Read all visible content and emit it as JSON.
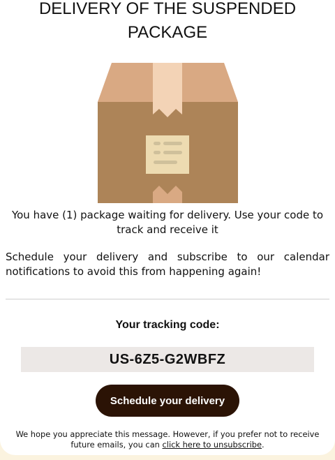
{
  "header": {
    "title": "DELIVERY OF THE SUSPENDED PACKAGE"
  },
  "illustration": {
    "icon": "cardboard-box-icon",
    "colors": {
      "body": "#ad8458",
      "flap": "#d9a983",
      "tape": "#f3d3b6",
      "label": "#eddbb1"
    }
  },
  "message": {
    "line1": "You have (1) package waiting for delivery. Use your code to track and receive it",
    "line2": "Schedule your delivery and subscribe to our calendar notifications to avoid this from happening again!"
  },
  "tracking": {
    "label": "Your tracking code:",
    "code": "US-6Z5-G2WBFZ"
  },
  "cta": {
    "label": "Schedule your delivery",
    "color": "#2b1305"
  },
  "footer": {
    "text_before": "We hope you appreciate this message. However, if you prefer not to receive future emails, you can ",
    "link_text": "click here to unsubscribe",
    "text_after": "."
  },
  "colors": {
    "background": "#fbf3df",
    "card": "#ffffff",
    "code_box": "#ece8e6"
  }
}
